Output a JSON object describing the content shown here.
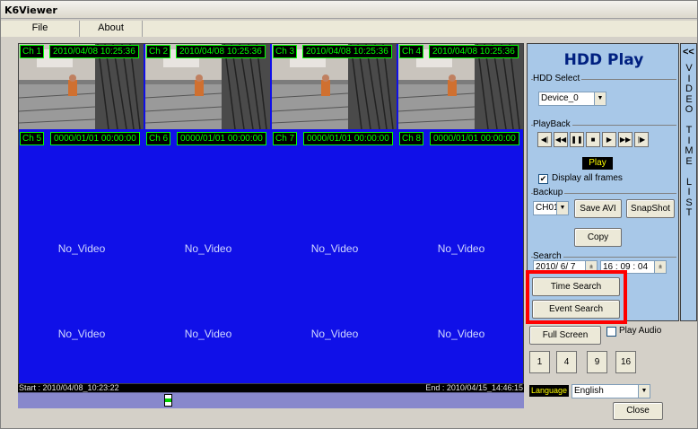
{
  "window": {
    "title": "K6Viewer"
  },
  "menu": [
    {
      "label": "File",
      "left": 0
    },
    {
      "label": "About"
    }
  ],
  "cameras": [
    {
      "ch": "Ch 1",
      "time": "2010/04/08 10:25:36"
    },
    {
      "ch": "Ch 2",
      "time": "2010/04/08 10:25:36"
    },
    {
      "ch": "Ch 3",
      "time": "2010/04/08 10:25:36"
    },
    {
      "ch": "Ch 4",
      "time": "2010/04/08 10:25:36"
    },
    {
      "ch": "Ch 5",
      "time": "0000/01/01 00:00:00"
    },
    {
      "ch": "Ch 6",
      "time": "0000/01/01 00:00:00"
    },
    {
      "ch": "Ch 7",
      "time": "0000/01/01 00:00:00"
    },
    {
      "ch": "Ch 8",
      "time": "0000/01/01 00:00:00"
    }
  ],
  "no_video_label": "No_Video",
  "timeline": {
    "start": "Start : 2010/04/08_10:23:22",
    "end": "End : 2010/04/15_14:46:15"
  },
  "panel": {
    "heading": "HDD Play",
    "hdd_select": {
      "label": "HDD Select",
      "value": "Device_0"
    },
    "playback": {
      "label": "PlayBack",
      "buttons": [
        {
          "name": "step-back",
          "glyph": "◀|"
        },
        {
          "name": "rewind",
          "glyph": "◀◀"
        },
        {
          "name": "pause",
          "glyph": "❚❚"
        },
        {
          "name": "stop",
          "glyph": "■"
        },
        {
          "name": "play",
          "glyph": "▶"
        },
        {
          "name": "fast-forward",
          "glyph": "▶▶"
        },
        {
          "name": "step-forward",
          "glyph": "|▶"
        }
      ],
      "status": "Play",
      "display_all_frames": "Display all frames"
    },
    "backup": {
      "label": "Backup",
      "channel": "CH01",
      "save_avi": "Save AVI",
      "snapshot": "SnapShot",
      "copy": "Copy"
    },
    "search": {
      "label": "Search",
      "date": "2010/ 6/ 7",
      "time": "16 : 09 : 04"
    }
  },
  "vtl": {
    "chevron": "<<",
    "text": "V\nI\nD\nE\nO\n\nT\nI\nM\nE\n\nL\nI\nS\nT"
  },
  "buttons": {
    "time_search": "Time Search",
    "event_search": "Event Search",
    "full_screen": "Full Screen",
    "play_audio": "Play Audio",
    "split": [
      "1",
      "4",
      "9",
      "16"
    ],
    "close": "Close"
  },
  "language": {
    "label": "Language",
    "value": "English"
  }
}
